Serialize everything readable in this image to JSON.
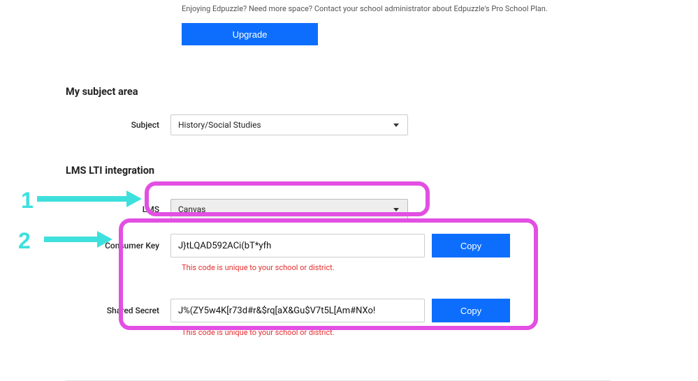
{
  "promo": {
    "text": "Enjoying Edpuzzle? Need more space? Contact your school administrator about Edpuzzle's Pro School Plan.",
    "upgrade_label": "Upgrade"
  },
  "subject_section": {
    "title": "My subject area",
    "label": "Subject",
    "selected": "History/Social Studies"
  },
  "lti_section": {
    "title": "LMS LTI integration",
    "lms_label": "LMS",
    "lms_selected": "Canvas",
    "consumer_key_label": "Consumer Key",
    "consumer_key_value": "J}tLQAD592ACi(bT*yfh",
    "consumer_key_hint": "This code is unique to your school or district.",
    "shared_secret_label": "Shared Secret",
    "shared_secret_value": "J%(ZY5w4K[r73d#r&$rq[aX&Gu$V7t5L[Am#NXo!",
    "shared_secret_hint": "This code is unique to your school or district.",
    "copy_label": "Copy"
  },
  "annotations": {
    "step1": "1",
    "step2": "2"
  }
}
